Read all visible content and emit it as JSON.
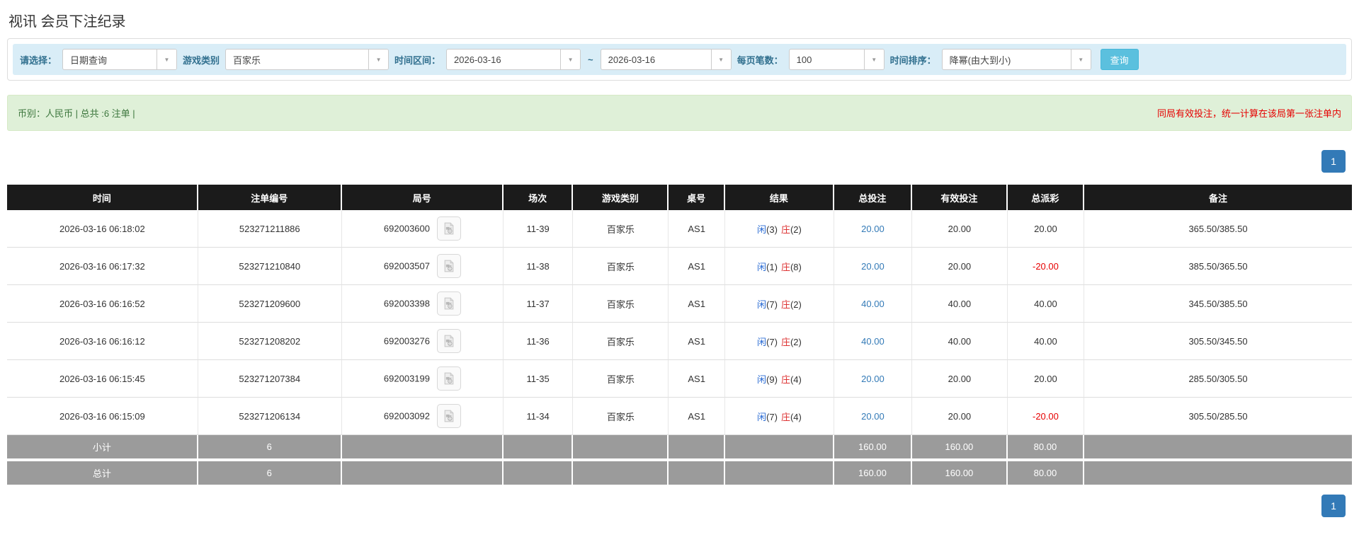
{
  "page": {
    "title": "视讯 会员下注纪录"
  },
  "filters": {
    "select_label": "请选择：",
    "select_value": "日期查询",
    "game_type_label": "游戏类别",
    "game_type_value": "百家乐",
    "time_range_label": "时间区间：",
    "date_from": "2026-03-16",
    "tilde": "~",
    "date_to": "2026-03-16",
    "page_size_label": "每页笔数：",
    "page_size_value": "100",
    "sort_label": "时间排序：",
    "sort_value": "降幂(由大到小)",
    "search_button": "查询"
  },
  "summary": {
    "left": "币别：人民币 | 总共 :6 注单 |",
    "right": "同局有效投注，统一计算在该局第一张注单内"
  },
  "pagination": {
    "page": "1"
  },
  "colors": {
    "accent_blue": "#337ab7",
    "filter_bar_bg": "#d9edf7",
    "summary_bg": "#dff0d8",
    "header_bg": "#1b1b1b",
    "subtotal_bg": "#9b9b9b",
    "negative_red": "#e60000",
    "player_blue": "#2b6cd4",
    "banker_red": "#dd3333",
    "search_button_bg": "#5bc0de"
  },
  "table": {
    "headers": [
      "时间",
      "注单编号",
      "局号",
      "场次",
      "游戏类别",
      "桌号",
      "结果",
      "总投注",
      "有效投注",
      "总派彩",
      "备注"
    ],
    "rows": [
      {
        "time": "2026-03-16 06:18:02",
        "bet_id": "523271211886",
        "round": "692003600",
        "session": "11-39",
        "game": "百家乐",
        "table_no": "AS1",
        "result": {
          "player_label": "闲",
          "player_score": "(3)",
          "banker_label": "庄",
          "banker_score": "(2)"
        },
        "total_bet": "20.00",
        "valid_bet": "20.00",
        "payout": "20.00",
        "note": "365.50/385.50"
      },
      {
        "time": "2026-03-16 06:17:32",
        "bet_id": "523271210840",
        "round": "692003507",
        "session": "11-38",
        "game": "百家乐",
        "table_no": "AS1",
        "result": {
          "player_label": "闲",
          "player_score": "(1)",
          "banker_label": "庄",
          "banker_score": "(8)"
        },
        "total_bet": "20.00",
        "valid_bet": "20.00",
        "payout": "-20.00",
        "note": "385.50/365.50"
      },
      {
        "time": "2026-03-16 06:16:52",
        "bet_id": "523271209600",
        "round": "692003398",
        "session": "11-37",
        "game": "百家乐",
        "table_no": "AS1",
        "result": {
          "player_label": "闲",
          "player_score": "(7)",
          "banker_label": "庄",
          "banker_score": "(2)"
        },
        "total_bet": "40.00",
        "valid_bet": "40.00",
        "payout": "40.00",
        "note": "345.50/385.50"
      },
      {
        "time": "2026-03-16 06:16:12",
        "bet_id": "523271208202",
        "round": "692003276",
        "session": "11-36",
        "game": "百家乐",
        "table_no": "AS1",
        "result": {
          "player_label": "闲",
          "player_score": "(7)",
          "banker_label": "庄",
          "banker_score": "(2)"
        },
        "total_bet": "40.00",
        "valid_bet": "40.00",
        "payout": "40.00",
        "note": "305.50/345.50"
      },
      {
        "time": "2026-03-16 06:15:45",
        "bet_id": "523271207384",
        "round": "692003199",
        "session": "11-35",
        "game": "百家乐",
        "table_no": "AS1",
        "result": {
          "player_label": "闲",
          "player_score": "(9)",
          "banker_label": "庄",
          "banker_score": "(4)"
        },
        "total_bet": "20.00",
        "valid_bet": "20.00",
        "payout": "20.00",
        "note": "285.50/305.50"
      },
      {
        "time": "2026-03-16 06:15:09",
        "bet_id": "523271206134",
        "round": "692003092",
        "session": "11-34",
        "game": "百家乐",
        "table_no": "AS1",
        "result": {
          "player_label": "闲",
          "player_score": "(7)",
          "banker_label": "庄",
          "banker_score": "(4)"
        },
        "total_bet": "20.00",
        "valid_bet": "20.00",
        "payout": "-20.00",
        "note": "305.50/285.50"
      }
    ],
    "subtotal": {
      "label": "小计",
      "count": "6",
      "total_bet": "160.00",
      "valid_bet": "160.00",
      "payout": "80.00"
    },
    "total": {
      "label": "总计",
      "count": "6",
      "total_bet": "160.00",
      "valid_bet": "160.00",
      "payout": "80.00"
    }
  }
}
